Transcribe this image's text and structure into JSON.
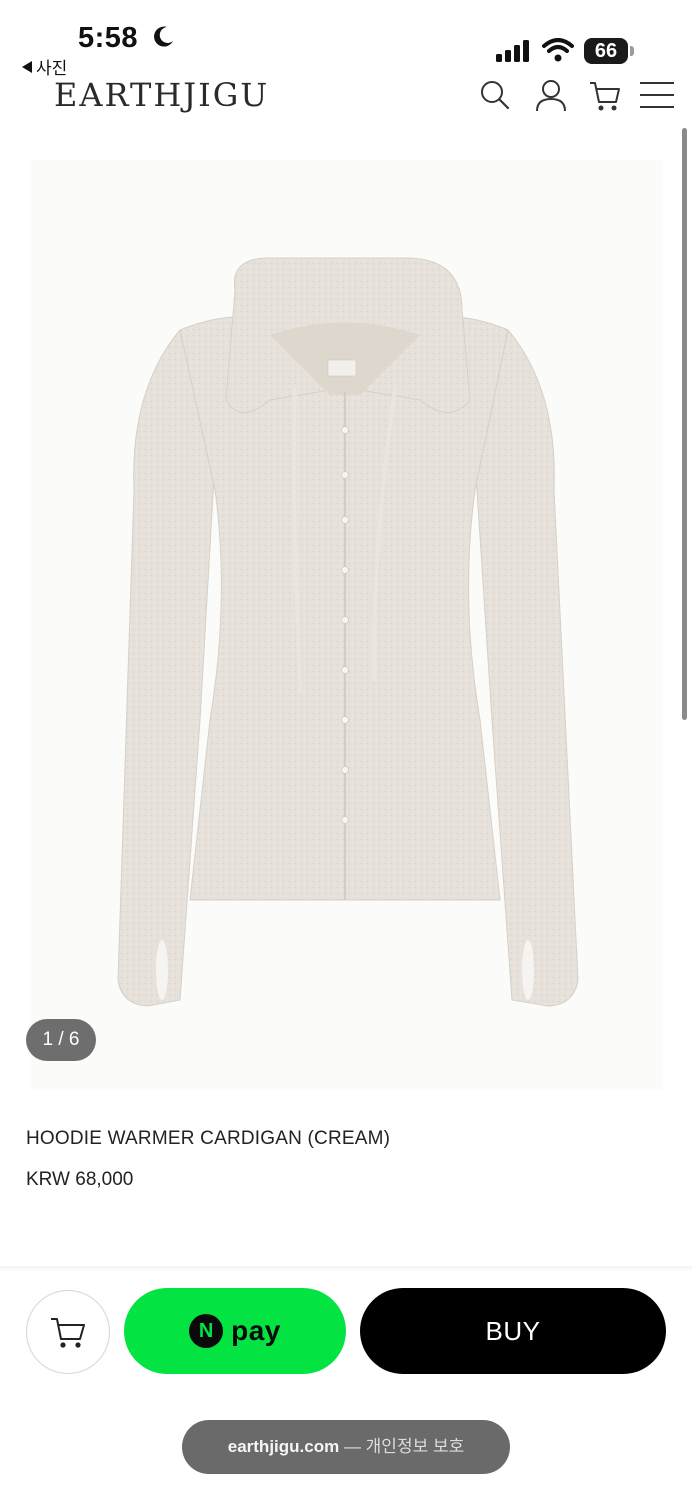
{
  "status_bar": {
    "time": "5:58",
    "battery_level": "66",
    "moon_icon": "moon-icon",
    "signal_icon": "cellular-signal-icon",
    "wifi_icon": "wifi-icon"
  },
  "back_link": {
    "label": "사진"
  },
  "header": {
    "logo": "EARTHJIGU",
    "icons": [
      "search-icon",
      "account-icon",
      "cart-icon",
      "menu-icon"
    ]
  },
  "gallery": {
    "counter": "1 / 6"
  },
  "product": {
    "name": "HOODIE WARMER CARDIGAN (CREAM)",
    "price": "KRW 68,000"
  },
  "actions": {
    "npay_logo": "N",
    "npay_label": "pay",
    "buy_label": "BUY"
  },
  "browser": {
    "url": "earthjigu.com",
    "note": " — 개인정보 보호"
  },
  "colors": {
    "npay_green": "#03e443",
    "buy_black": "#000000",
    "garment_cream": "#e6e1da"
  }
}
